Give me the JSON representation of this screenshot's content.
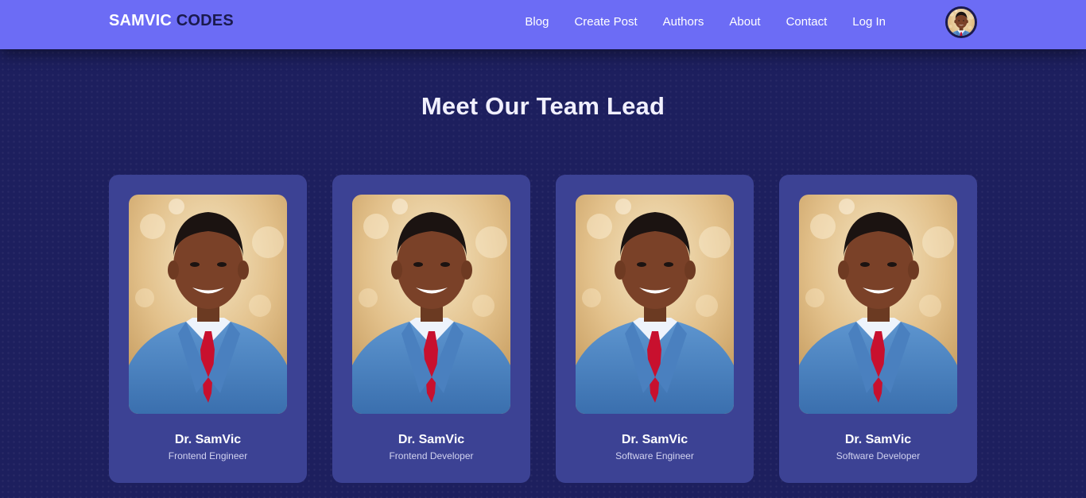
{
  "header": {
    "logo_part1": "SAMVIC",
    "logo_part2": "CODES",
    "nav": [
      "Blog",
      "Create Post",
      "Authors",
      "About",
      "Contact",
      "Log In"
    ]
  },
  "section": {
    "title": "Meet Our Team Lead"
  },
  "team": [
    {
      "name": "Dr. SamVic",
      "role": "Frontend Engineer"
    },
    {
      "name": "Dr. SamVic",
      "role": "Frontend Developer"
    },
    {
      "name": "Dr. SamVic",
      "role": "Software Engineer"
    },
    {
      "name": "Dr. SamVic",
      "role": "Software Developer"
    }
  ],
  "colors": {
    "navbar": "#6c6cf5",
    "background": "#1d1f5e",
    "card": "#3c4294",
    "logo_dark": "#1a1a4e"
  }
}
